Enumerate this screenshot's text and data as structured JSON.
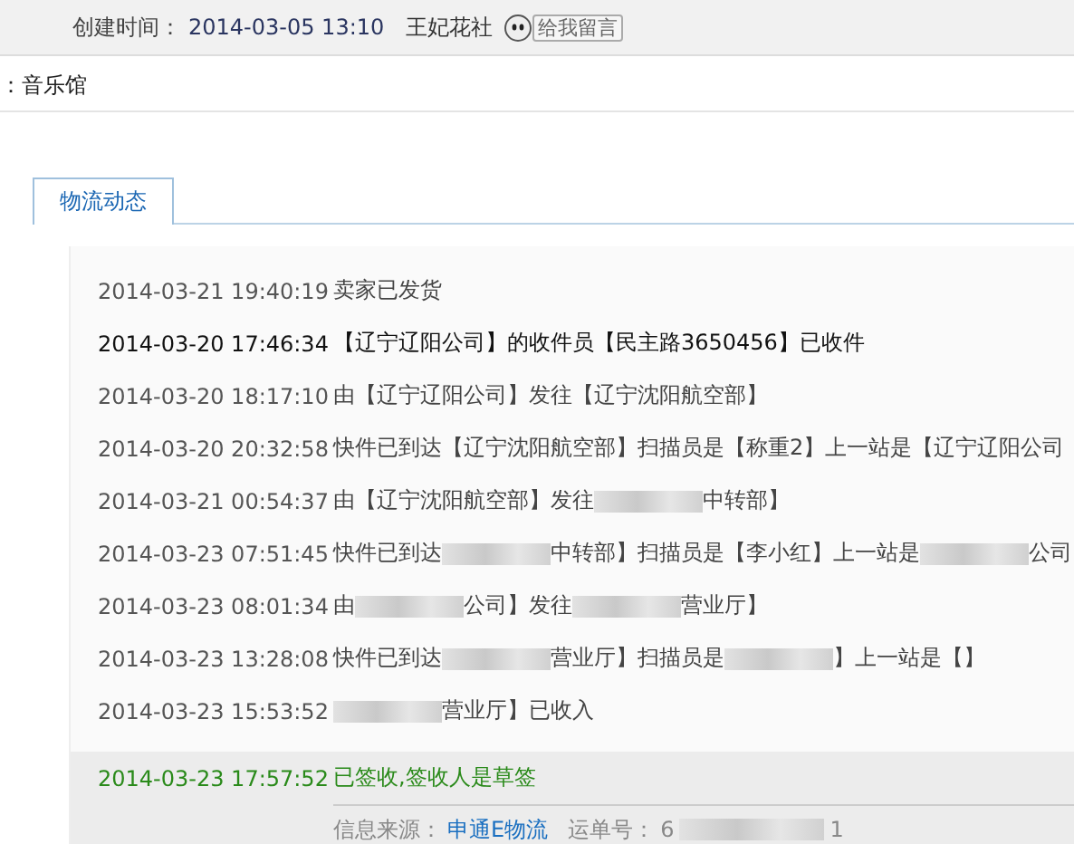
{
  "header": {
    "created_label": "创建时间：",
    "created_time": "2014-03-05 13:10",
    "shop": "王妃花社",
    "message_button": "给我留言"
  },
  "category": "：音乐馆",
  "tabs": [
    {
      "label": "物流动态",
      "selected": true
    }
  ],
  "events": [
    {
      "time": "2014-03-21 19:40:19",
      "emphasized": false,
      "highlighted": false,
      "parts": [
        {
          "kind": "text",
          "text": "卖家已发货"
        }
      ]
    },
    {
      "time": "2014-03-20 17:46:34",
      "emphasized": true,
      "highlighted": false,
      "parts": [
        {
          "kind": "text",
          "text": "【辽宁辽阳公司】的收件员【民主路3650456】已收件"
        }
      ]
    },
    {
      "time": "2014-03-20 18:17:10",
      "emphasized": false,
      "highlighted": false,
      "parts": [
        {
          "kind": "text",
          "text": "由【辽宁辽阳公司】发往【辽宁沈阳航空部】"
        }
      ]
    },
    {
      "time": "2014-03-20 20:32:58",
      "emphasized": false,
      "highlighted": false,
      "parts": [
        {
          "kind": "text",
          "text": "快件已到达【辽宁沈阳航空部】扫描员是【称重2】上一站是【辽宁辽阳公司"
        }
      ]
    },
    {
      "time": "2014-03-21 00:54:37",
      "emphasized": false,
      "highlighted": false,
      "parts": [
        {
          "kind": "text",
          "text": "由【辽宁沈阳航空部】发往"
        },
        {
          "kind": "blur"
        },
        {
          "kind": "text",
          "text": "中转部】"
        }
      ]
    },
    {
      "time": "2014-03-23 07:51:45",
      "emphasized": false,
      "highlighted": false,
      "parts": [
        {
          "kind": "text",
          "text": "快件已到达"
        },
        {
          "kind": "blur"
        },
        {
          "kind": "text",
          "text": "中转部】扫描员是【李小红】上一站是"
        },
        {
          "kind": "blur"
        },
        {
          "kind": "text",
          "text": "公司"
        }
      ]
    },
    {
      "time": "2014-03-23 08:01:34",
      "emphasized": false,
      "highlighted": false,
      "parts": [
        {
          "kind": "text",
          "text": "由"
        },
        {
          "kind": "blur"
        },
        {
          "kind": "text",
          "text": "公司】发往"
        },
        {
          "kind": "blur"
        },
        {
          "kind": "text",
          "text": "营业厅】"
        }
      ]
    },
    {
      "time": "2014-03-23 13:28:08",
      "emphasized": false,
      "highlighted": false,
      "parts": [
        {
          "kind": "text",
          "text": "快件已到达"
        },
        {
          "kind": "blur"
        },
        {
          "kind": "text",
          "text": "营业厅】扫描员是"
        },
        {
          "kind": "blur"
        },
        {
          "kind": "text",
          "text": "】上一站是【】"
        }
      ]
    },
    {
      "time": "2014-03-23 15:53:52",
      "emphasized": false,
      "highlighted": false,
      "parts": [
        {
          "kind": "blur"
        },
        {
          "kind": "text",
          "text": "营业厅】已收入"
        }
      ]
    },
    {
      "time": "2014-03-23 17:57:52",
      "emphasized": false,
      "highlighted": true,
      "parts": [
        {
          "kind": "text",
          "text": "已签收,签收人是草签"
        }
      ]
    }
  ],
  "footer": {
    "source_label": "信息来源：",
    "source_link": "申通E物流",
    "waybill_label": "运单号：",
    "waybill_visible_start": "6",
    "waybill_visible_end": "1"
  }
}
